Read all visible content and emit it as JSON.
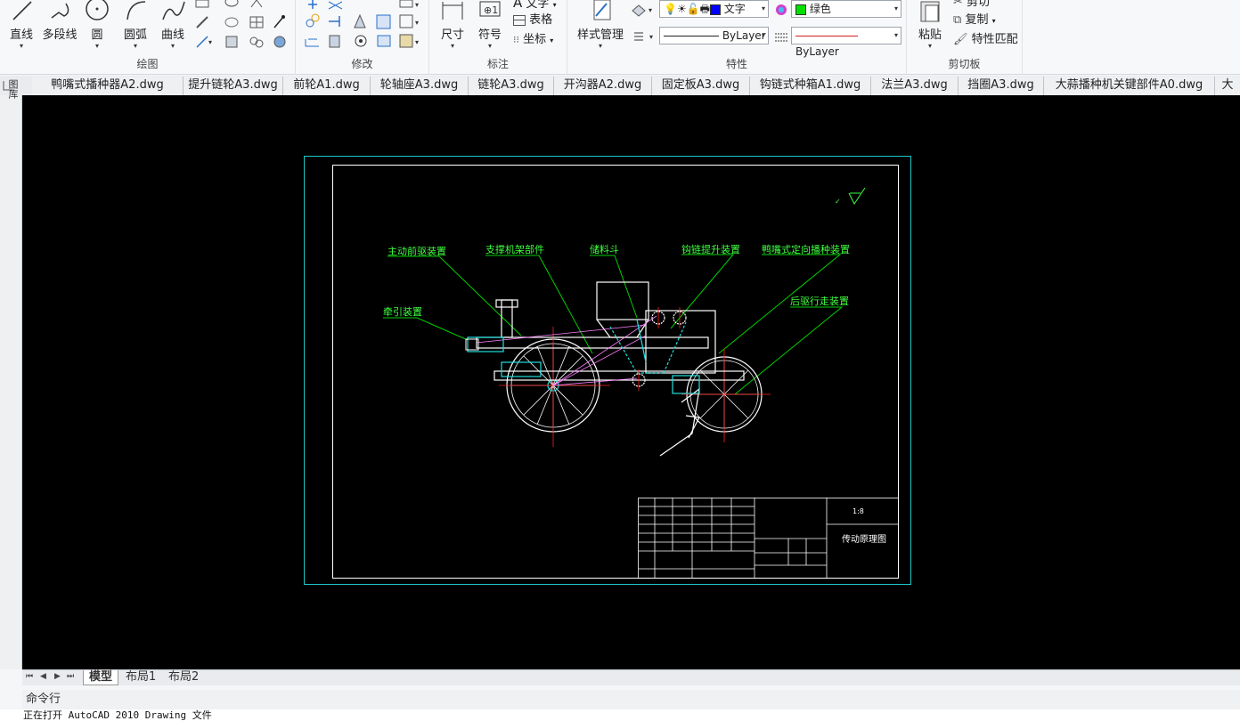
{
  "ribbon": {
    "draw_panel": {
      "title": "绘图",
      "line": "直线",
      "polyline": "多段线",
      "circle": "圆",
      "arc": "圆弧",
      "spline": "曲线"
    },
    "modify_panel": {
      "title": "修改"
    },
    "annotation_panel": {
      "title": "标注",
      "dimension": "尺寸",
      "symbol": "符号",
      "text": "文字",
      "table": "表格",
      "coordinate": "坐标"
    },
    "properties_panel": {
      "title": "特性",
      "style_manager": "样式管理",
      "layer_name": "文字",
      "color_value": "绿色",
      "color_swatch": "#00e000",
      "linetype": "ByLayer",
      "lineweight": "ByLayer"
    },
    "clipboard_panel": {
      "title": "剪切板",
      "paste": "粘贴",
      "cut": "剪切",
      "copy": "复制",
      "match_properties": "特性匹配"
    }
  },
  "doc_tabs": [
    "鸭嘴式播种器A2.dwg",
    "提升链轮A3.dwg",
    "前轮A1.dwg",
    "轮轴座A3.dwg",
    "链轮A3.dwg",
    "开沟器A2.dwg",
    "固定板A3.dwg",
    "钩链式种箱A1.dwg",
    "法兰A3.dwg",
    "挡圈A3.dwg",
    "大蒜播种机关键部件A0.dwg",
    "大"
  ],
  "sidebar_label": "图库",
  "drawing": {
    "labels": {
      "drive": "主动前驱装置",
      "frame": "支撑机架部件",
      "hopper": "储料斗",
      "chain_lift": "钩链提升装置",
      "duckbill": "鸭嘴式定向播种装置",
      "traction": "牵引装置",
      "rear_wheel": "后驱行走装置"
    },
    "title_block": {
      "drawing_name": "传动原理图",
      "scale": "1:8"
    }
  },
  "layout_tabs": [
    "模型",
    "布局1",
    "布局2"
  ],
  "command_label": "命令行",
  "status_text": "正在打开 AutoCAD 2010 Drawing 文件"
}
